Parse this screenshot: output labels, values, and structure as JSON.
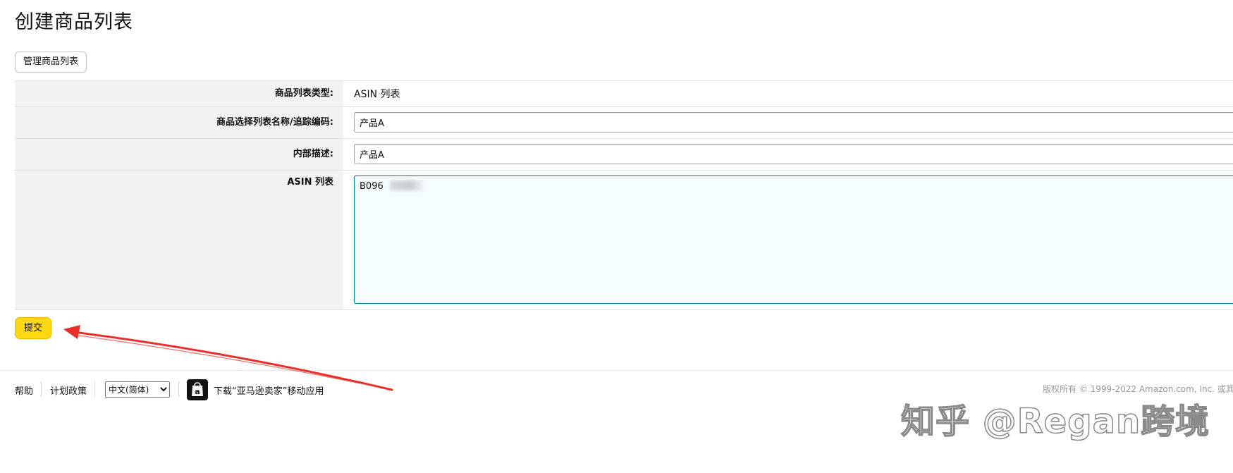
{
  "page": {
    "title": "创建商品列表"
  },
  "toolbar": {
    "manage_label": "管理商品列表"
  },
  "form": {
    "type": {
      "label": "商品列表类型:",
      "value": "ASIN 列表"
    },
    "name": {
      "label": "商品选择列表名称/追踪编码:",
      "value": "产品A"
    },
    "description": {
      "label": "内部描述:",
      "value": "产品A"
    },
    "asins": {
      "label": "ASIN 列表",
      "value": "B096"
    }
  },
  "actions": {
    "submit_label": "提交"
  },
  "footer": {
    "help": "帮助",
    "policies": "计划政策",
    "language": {
      "selected": "中文(简体)"
    },
    "app_download": "下载“亚马逊卖家”移动应用",
    "copyright": "版权所有 © 1999-2022 Amazon.com, Inc. 或其"
  },
  "watermark": {
    "text": "知乎 @Regan跨境"
  },
  "annotation": {
    "arrow_color": "#e8302a"
  },
  "colors": {
    "accent_button": "#ffd814",
    "focus_border": "#008296"
  }
}
